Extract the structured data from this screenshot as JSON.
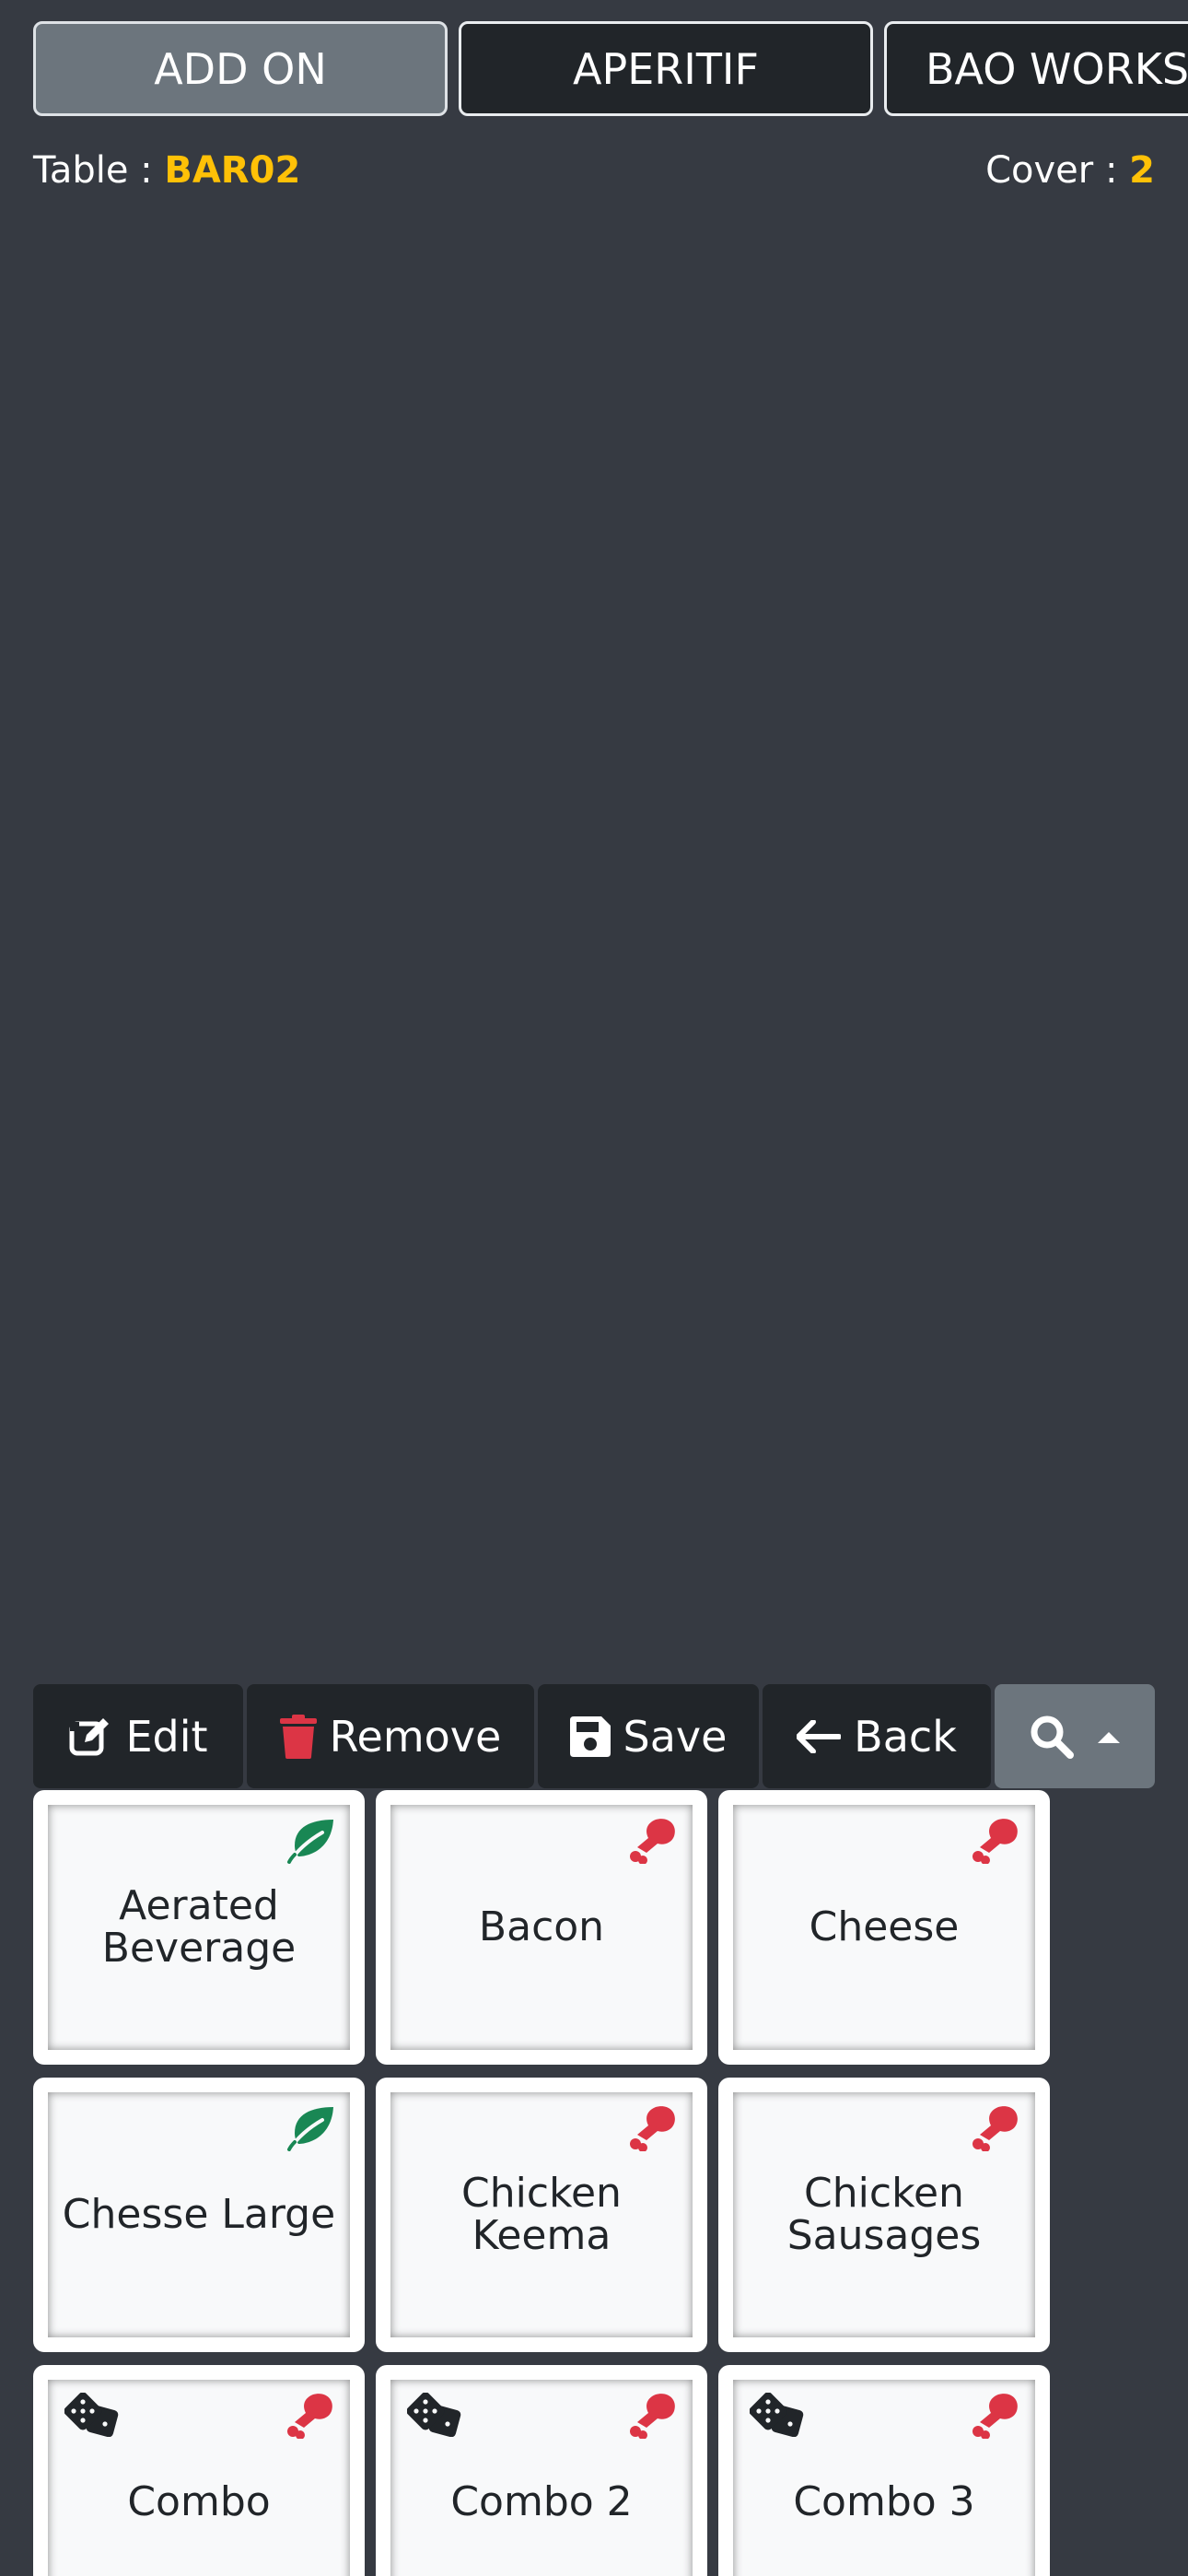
{
  "categories": [
    {
      "label": "ADD ON",
      "active": true
    },
    {
      "label": "APERITIF",
      "active": false
    },
    {
      "label": "BAO WORKSHOP",
      "active": false
    }
  ],
  "order_info": {
    "table_label": "Table :",
    "table_value": "BAR02",
    "cover_label": "Cover :",
    "cover_value": "2"
  },
  "actions": {
    "edit": "Edit",
    "remove": "Remove",
    "save": "Save",
    "back": "Back"
  },
  "colors": {
    "veg": "#198754",
    "nonveg": "#dc3545",
    "accent": "#ffc107"
  },
  "products": [
    {
      "name": "Aerated Beverage",
      "diet": "veg-leaf-icon",
      "combo": false
    },
    {
      "name": "Bacon",
      "diet": "nonveg-drumstick-icon",
      "combo": false
    },
    {
      "name": "Cheese",
      "diet": "nonveg-drumstick-icon",
      "combo": false
    },
    {
      "name": "Chesse Large",
      "diet": "veg-leaf-icon",
      "combo": false
    },
    {
      "name": "Chicken Keema",
      "diet": "nonveg-drumstick-icon",
      "combo": false
    },
    {
      "name": "Chicken Sausages",
      "diet": "nonveg-drumstick-icon",
      "combo": false
    },
    {
      "name": "Combo",
      "diet": "nonveg-drumstick-icon",
      "combo": true
    },
    {
      "name": "Combo 2",
      "diet": "nonveg-drumstick-icon",
      "combo": true
    },
    {
      "name": "Combo 3",
      "diet": "nonveg-drumstick-icon",
      "combo": true
    }
  ]
}
